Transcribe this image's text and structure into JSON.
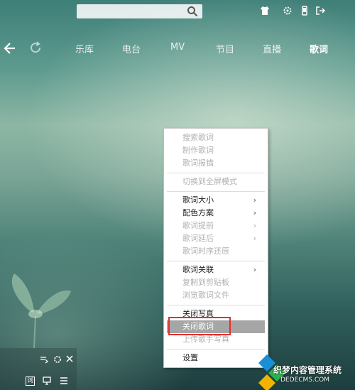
{
  "nav": {
    "tabs": [
      "乐库",
      "电台",
      "MV",
      "节目",
      "直播",
      "歌词"
    ],
    "active_tab": "歌词"
  },
  "context_menu": {
    "items": [
      {
        "label": "搜索歌词",
        "enabled": false
      },
      {
        "label": "制作歌词",
        "enabled": false
      },
      {
        "label": "歌词报错",
        "enabled": false
      },
      {
        "label": "切换到全屏模式",
        "enabled": false
      },
      {
        "label": "歌词大小",
        "enabled": true,
        "submenu": true
      },
      {
        "label": "配色方案",
        "enabled": true,
        "submenu": true
      },
      {
        "label": "歌词提前",
        "enabled": false,
        "submenu": true
      },
      {
        "label": "歌词延后",
        "enabled": false,
        "submenu": true
      },
      {
        "label": "歌词时序还原",
        "enabled": false
      },
      {
        "label": "歌词关联",
        "enabled": true,
        "submenu": true
      },
      {
        "label": "复制到剪贴板",
        "enabled": false
      },
      {
        "label": "浏览歌词文件",
        "enabled": false
      },
      {
        "label": "关闭写真",
        "enabled": true
      },
      {
        "label": "关闭歌词",
        "enabled": true,
        "highlighted": true
      },
      {
        "label": "上传歌手写真",
        "enabled": false
      },
      {
        "label": "设置",
        "enabled": true
      }
    ],
    "submenu_arrow": "›"
  },
  "mini_player": {
    "lyrics_label": "词"
  },
  "watermark": {
    "line1": "织梦内容管理系统",
    "line2": "DEDECMS.COM"
  },
  "icons": [
    "search-icon",
    "shirt-icon",
    "gear-icon",
    "phone-icon",
    "exit-icon",
    "back-icon",
    "refresh-icon"
  ],
  "colors": {
    "highlight": "#a6a6a6",
    "annotation_box": "#e03030"
  }
}
